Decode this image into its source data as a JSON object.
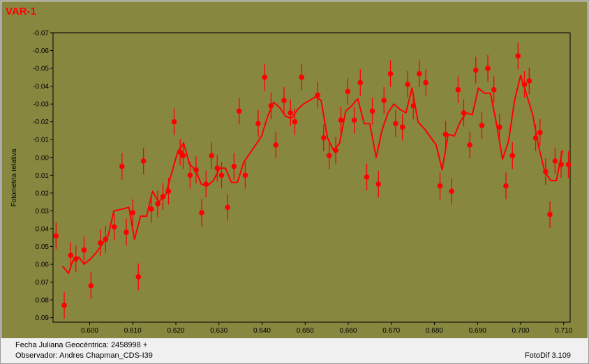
{
  "chart_data": {
    "type": "scatter",
    "title": "VAR-1",
    "xlabel": "",
    "ylabel": "Fotometria relativa",
    "xlim": [
      0.5915,
      0.7115
    ],
    "ylim": [
      -0.07,
      0.0925
    ],
    "y_inverted": true,
    "grid": false,
    "x_ticks": [
      0.6,
      0.61,
      0.62,
      0.63,
      0.64,
      0.65,
      0.66,
      0.67,
      0.68,
      0.69,
      0.7,
      0.71
    ],
    "x_tick_labels": [
      "0.600",
      "0.610",
      "0.620",
      "0.630",
      "0.640",
      "0.650",
      "0.660",
      "0.670",
      "0.680",
      "0.690",
      "0.700",
      "0.710"
    ],
    "y_ticks": [
      -0.07,
      -0.06,
      -0.05,
      -0.04,
      -0.03,
      -0.02,
      -0.01,
      0.0,
      0.01,
      0.02,
      0.03,
      0.04,
      0.05,
      0.06,
      0.07,
      0.08,
      0.09
    ],
    "y_tick_labels": [
      "-0.07",
      "-0.06",
      "-0.05",
      "-0.04",
      "-0.03",
      "-0.02",
      "-0.01",
      "0.00",
      "0.01",
      "0.02",
      "0.03",
      "0.04",
      "0.05",
      "0.06",
      "0.07",
      "0.08",
      "0.09"
    ],
    "error_bar": 0.0075,
    "colors": {
      "background": "#888740",
      "data": "#ff0000",
      "axis": "#000000"
    },
    "series": [
      {
        "type": "points",
        "x": [
          0.5922,
          0.5941,
          0.5956,
          0.5968,
          0.5987,
          0.6003,
          0.6025,
          0.6037,
          0.6057,
          0.6075,
          0.6085,
          0.61,
          0.6113,
          0.6125,
          0.6143,
          0.6158,
          0.617,
          0.6183,
          0.6196,
          0.621,
          0.6217,
          0.6233,
          0.6247,
          0.626,
          0.627,
          0.6283,
          0.6296,
          0.6306,
          0.632,
          0.6335,
          0.6347,
          0.6361,
          0.6391,
          0.6406,
          0.6421,
          0.6432,
          0.6451,
          0.6466,
          0.6476,
          0.6492,
          0.6529,
          0.6543,
          0.6556,
          0.6571,
          0.6583,
          0.6599,
          0.6614,
          0.6628,
          0.6643,
          0.6656,
          0.667,
          0.6683,
          0.6698,
          0.671,
          0.6726,
          0.6738,
          0.6751,
          0.6765,
          0.678,
          0.6813,
          0.6826,
          0.684,
          0.6855,
          0.6868,
          0.6882,
          0.6896,
          0.691,
          0.6924,
          0.6938,
          0.6951,
          0.6966,
          0.6981,
          0.6994,
          0.7009,
          0.702,
          0.7035,
          0.7045,
          0.7058,
          0.7068,
          0.708,
          0.7094,
          0.7111
        ],
        "y": [
          0.044,
          0.083,
          0.055,
          0.057,
          0.052,
          0.072,
          0.048,
          0.046,
          0.039,
          0.005,
          0.042,
          0.031,
          0.067,
          0.002,
          0.029,
          0.026,
          0.022,
          0.019,
          -0.02,
          -0.003,
          -0.001,
          0.01,
          0.007,
          0.031,
          0.015,
          -0.001,
          0.006,
          0.01,
          0.028,
          0.005,
          -0.026,
          0.01,
          -0.019,
          -0.045,
          -0.029,
          -0.007,
          -0.032,
          -0.025,
          -0.02,
          -0.045,
          -0.035,
          -0.011,
          -0.001,
          -0.004,
          -0.021,
          -0.037,
          -0.021,
          -0.042,
          0.011,
          -0.026,
          0.015,
          -0.032,
          -0.047,
          -0.019,
          -0.017,
          -0.041,
          -0.029,
          -0.047,
          -0.042,
          0.016,
          -0.013,
          0.019,
          -0.038,
          -0.025,
          -0.007,
          -0.049,
          -0.018,
          -0.05,
          -0.038,
          -0.017,
          0.016,
          -0.001,
          -0.057,
          -0.041,
          -0.043,
          -0.011,
          -0.014,
          0.008,
          0.032,
          0.002,
          0.004,
          0.004
        ]
      },
      {
        "type": "line",
        "x": [
          0.5937,
          0.5951,
          0.5961,
          0.5975,
          0.5987,
          0.6002,
          0.6017,
          0.6031,
          0.6043,
          0.6056,
          0.6076,
          0.6091,
          0.6104,
          0.6118,
          0.6132,
          0.6146,
          0.616,
          0.6176,
          0.619,
          0.6204,
          0.6218,
          0.6232,
          0.6246,
          0.6259,
          0.6273,
          0.6287,
          0.6302,
          0.6315,
          0.6329,
          0.6343,
          0.6357,
          0.6371,
          0.6399,
          0.6413,
          0.6427,
          0.6441,
          0.6455,
          0.6469,
          0.6483,
          0.6496,
          0.6524,
          0.6537,
          0.6552,
          0.6566,
          0.658,
          0.6594,
          0.6608,
          0.6622,
          0.6637,
          0.665,
          0.6665,
          0.6678,
          0.6692,
          0.6706,
          0.672,
          0.6734,
          0.6748,
          0.6762,
          0.6777,
          0.6804,
          0.6818,
          0.6832,
          0.6846,
          0.686,
          0.6874,
          0.6888,
          0.6902,
          0.6916,
          0.693,
          0.6944,
          0.6958,
          0.6972,
          0.6986,
          0.7,
          0.7013,
          0.7028,
          0.7042,
          0.7056,
          0.707,
          0.7083,
          0.7097
        ],
        "y": [
          0.061,
          0.065,
          0.058,
          0.056,
          0.06,
          0.057,
          0.053,
          0.048,
          0.044,
          0.03,
          0.029,
          0.028,
          0.046,
          0.033,
          0.033,
          0.019,
          0.025,
          0.021,
          0.009,
          -0.003,
          -0.008,
          0.004,
          0.007,
          0.015,
          0.016,
          0.013,
          0.006,
          0.006,
          0.014,
          0.014,
          0.003,
          -0.002,
          -0.012,
          -0.023,
          -0.031,
          -0.028,
          -0.023,
          -0.022,
          -0.027,
          -0.03,
          -0.034,
          -0.032,
          -0.011,
          -0.004,
          -0.008,
          -0.026,
          -0.029,
          -0.033,
          -0.019,
          -0.019,
          0.0,
          -0.015,
          -0.025,
          -0.03,
          -0.027,
          -0.025,
          -0.039,
          -0.02,
          -0.016,
          -0.007,
          0.007,
          -0.013,
          -0.012,
          -0.02,
          -0.025,
          -0.024,
          -0.039,
          -0.036,
          -0.036,
          -0.019,
          0.001,
          -0.009,
          -0.032,
          -0.046,
          -0.036,
          -0.024,
          -0.006,
          0.008,
          0.013,
          0.013,
          -0.004
        ]
      }
    ]
  },
  "footer": {
    "line1": "Fecha Juliana Geocéntrica: 2458998 +",
    "line2": "Observador: Andres Chapman_CDS-I39",
    "software": "FotoDif 3.109"
  }
}
